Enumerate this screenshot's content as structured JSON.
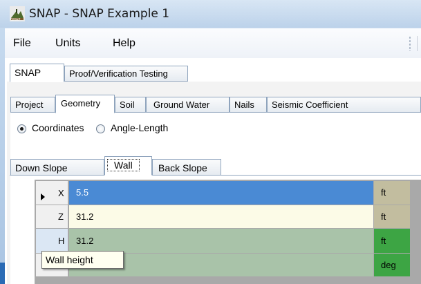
{
  "window": {
    "title": "SNAP - SNAP Example 1",
    "app_icon": "snap-logo-icon"
  },
  "menu": {
    "items": [
      "File",
      "Units",
      "Help"
    ]
  },
  "outer_tabs": {
    "items": [
      "SNAP",
      "Proof/Verification Testing"
    ],
    "selected": "SNAP"
  },
  "inner_tabs": {
    "items": [
      "Project",
      "Geometry",
      "Soil",
      "Ground Water",
      "Nails",
      "Seismic Coefficient"
    ],
    "selected": "Geometry"
  },
  "geometry_mode": {
    "options": [
      "Coordinates",
      "Angle-Length"
    ],
    "selected": "Coordinates"
  },
  "sub_tabs": {
    "items": [
      "Down Slope",
      "Wall",
      "Back Slope"
    ],
    "selected": "Wall"
  },
  "grid": {
    "rows": [
      {
        "label": "X",
        "value": "5.5",
        "unit": "ft",
        "current": true
      },
      {
        "label": "Z",
        "value": "31.2",
        "unit": "ft"
      },
      {
        "label": "H",
        "value": "31.2",
        "unit": "ft"
      },
      {
        "label": "",
        "value": "",
        "unit": "deg"
      }
    ]
  },
  "tooltip": {
    "text": "Wall height"
  },
  "colors": {
    "selected_value": "#4a8ad4",
    "edit_value": "#fcfbe7",
    "readonly_value": "#a9c3a9",
    "unit_cell": "#c2bd9f",
    "unit_cell_active": "#3da544",
    "tooltip_bg": "#fffff0"
  }
}
